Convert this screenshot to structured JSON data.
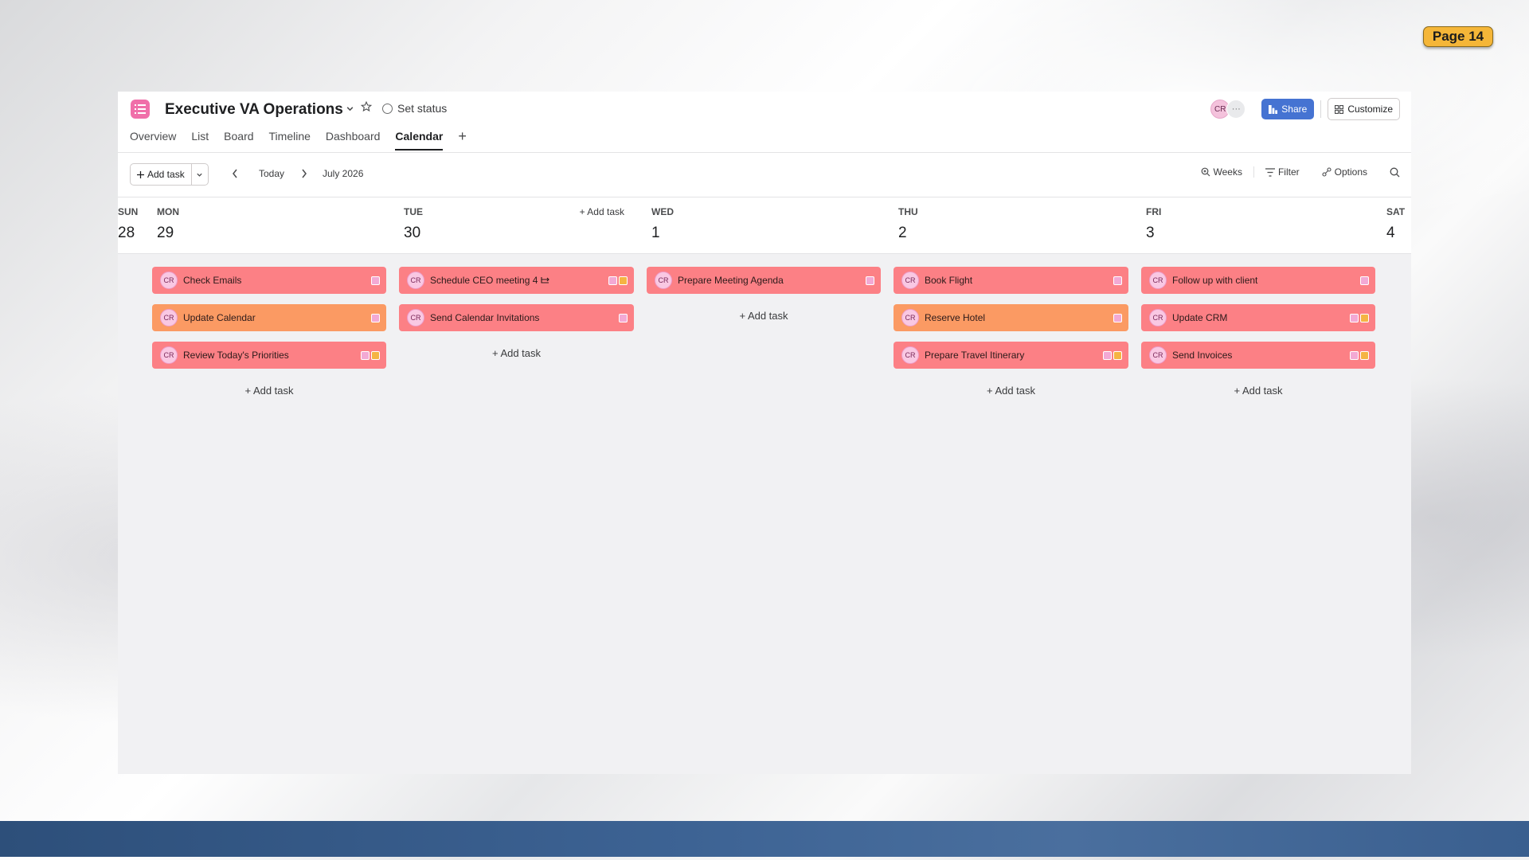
{
  "page_badge": "Page 14",
  "project": {
    "title": "Executive VA Operations",
    "set_status": "Set status"
  },
  "header_right": {
    "avatar": "CR",
    "more": "···",
    "share_label": "Share",
    "customize_label": "Customize"
  },
  "tabs": [
    {
      "label": "Overview"
    },
    {
      "label": "List"
    },
    {
      "label": "Board"
    },
    {
      "label": "Timeline"
    },
    {
      "label": "Dashboard"
    },
    {
      "label": "Calendar",
      "active": true
    }
  ],
  "tab_add": "+",
  "toolbar": {
    "add_task": "Add task",
    "today": "Today",
    "month": "July 2026",
    "weeks": "Weeks",
    "filter": "Filter",
    "options": "Options"
  },
  "colors": {
    "task_red": "#fc8085",
    "task_orange": "#fb9a63",
    "share_blue": "#4573d2",
    "project_icon": "#f06fa9"
  },
  "days": [
    {
      "name": "SUN",
      "num": "28",
      "tasks": []
    },
    {
      "name": "MON",
      "num": "29",
      "add_label": "+ Add task",
      "tasks": [
        {
          "avatar": "CR",
          "name": "Check Emails",
          "color": "red",
          "tags": [
            "pink"
          ]
        },
        {
          "avatar": "CR",
          "name": "Update Calendar",
          "color": "orange",
          "tags": [
            "pink"
          ]
        },
        {
          "avatar": "CR",
          "name": "Review Today's Priorities",
          "color": "red",
          "tags": [
            "pink",
            "amber"
          ]
        }
      ]
    },
    {
      "name": "TUE",
      "num": "30",
      "header_add": "+ Add task",
      "add_label": "+ Add task",
      "tasks": [
        {
          "avatar": "CR",
          "name": "Schedule CEO meeting 4",
          "color": "red",
          "tags": [
            "pink",
            "amber"
          ],
          "subtask_icon": true
        },
        {
          "avatar": "CR",
          "name": "Send Calendar Invitations",
          "color": "red",
          "tags": [
            "pink"
          ]
        }
      ]
    },
    {
      "name": "WED",
      "num": "1",
      "add_label": "+ Add task",
      "tasks": [
        {
          "avatar": "CR",
          "name": "Prepare Meeting Agenda",
          "color": "red",
          "tags": [
            "pink"
          ]
        }
      ]
    },
    {
      "name": "THU",
      "num": "2",
      "add_label": "+ Add task",
      "tasks": [
        {
          "avatar": "CR",
          "name": "Book Flight",
          "color": "red",
          "tags": [
            "pink"
          ]
        },
        {
          "avatar": "CR",
          "name": "Reserve Hotel",
          "color": "orange",
          "tags": [
            "pink"
          ]
        },
        {
          "avatar": "CR",
          "name": "Prepare Travel Itinerary",
          "color": "red",
          "tags": [
            "pink",
            "amber"
          ]
        }
      ]
    },
    {
      "name": "FRI",
      "num": "3",
      "add_label": "+ Add task",
      "tasks": [
        {
          "avatar": "CR",
          "name": "Follow up with client",
          "color": "red",
          "tags": [
            "pink"
          ]
        },
        {
          "avatar": "CR",
          "name": "Update CRM",
          "color": "red",
          "tags": [
            "pink",
            "amber"
          ]
        },
        {
          "avatar": "CR",
          "name": "Send Invoices",
          "color": "red",
          "tags": [
            "pink",
            "amber"
          ]
        }
      ]
    },
    {
      "name": "SAT",
      "num": "4",
      "tasks": []
    }
  ]
}
